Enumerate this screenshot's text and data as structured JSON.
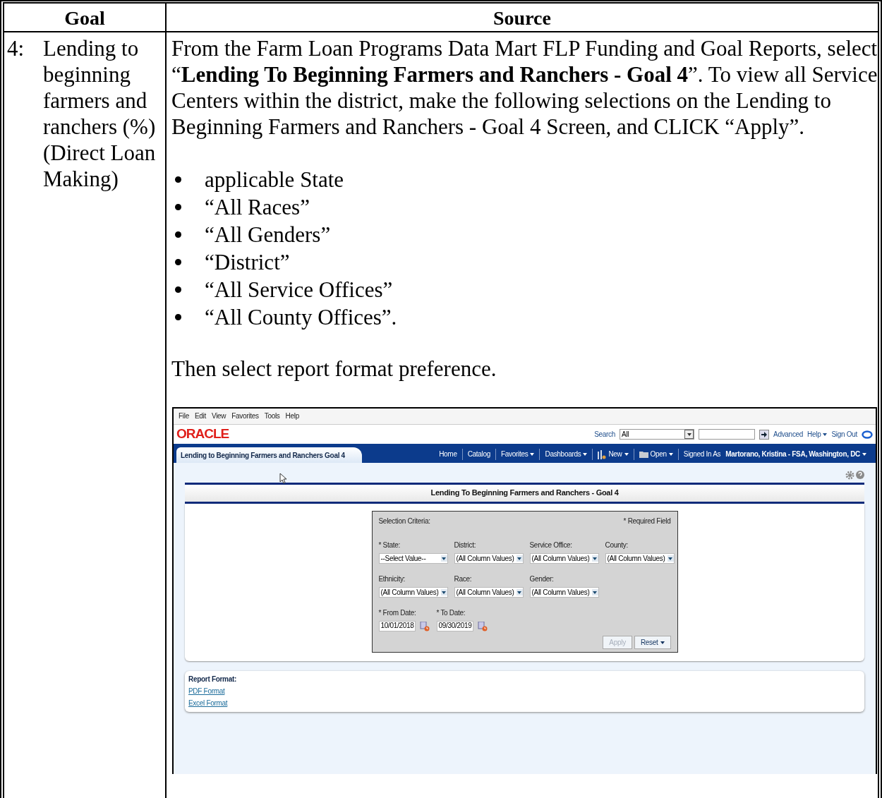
{
  "table": {
    "columns": [
      "Goal",
      "Source"
    ],
    "rows": [
      {
        "goal_number": "4:",
        "goal": "Lending to beginning farmers and ranchers (%) (Direct Loan Making)",
        "source": {
          "paragraph": "From the Farm Loan Programs Data Mart FLP Funding and Goal Reports, select “**Lending To Beginning Farmers and Ranchers - Goal 4**”.  To view all Service Centers within the district, make the following selections on the Lending to Beginning Farmers and Ranchers - Goal 4 Screen, and CLICK “Apply”.",
          "bullets": [
            "applicable State",
            "“All Races”",
            "“All Genders”",
            "“District”",
            "“All Service Offices”",
            "“All County Offices”."
          ],
          "closing": "Then select report format preference.",
          "screenshot": {
            "menu_bar": [
              "File",
              "Edit",
              "View",
              "Favorites",
              "Tools",
              "Help"
            ],
            "header": {
              "logo": "ORACLE",
              "search_label": "Search",
              "search_scope": "All",
              "links": [
                {
                  "label": "Advanced",
                  "dropdown": false
                },
                {
                  "label": "Help",
                  "dropdown": true
                },
                {
                  "label": "Sign Out",
                  "dropdown": false
                }
              ]
            },
            "nav": {
              "tab": "Lending to Beginning Farmers and Ranchers Goal 4",
              "items": [
                {
                  "label": "Home",
                  "kind": "link",
                  "dropdown": false
                },
                {
                  "label": "Catalog",
                  "kind": "link",
                  "dropdown": false
                },
                {
                  "label": "Favorites",
                  "kind": "link",
                  "dropdown": true
                },
                {
                  "label": "Dashboards",
                  "kind": "link",
                  "dropdown": true
                },
                {
                  "label": "New",
                  "kind": "new",
                  "dropdown": true
                },
                {
                  "label": "Open",
                  "kind": "open",
                  "dropdown": true
                }
              ],
              "signed_in_label": "Signed In As",
              "user": "Martorano, Kristina - FSA, Washington, DC"
            },
            "page_title": "Lending To Beginning Farmers and Ranchers - Goal 4",
            "prompt": {
              "heading": "Selection Criteria:",
              "required_note": "* Required Field",
              "rows": [
                [
                  {
                    "label": "* State:",
                    "value": "--Select Value--"
                  },
                  {
                    "label": "District:",
                    "value": "(All Column Values)"
                  },
                  {
                    "label": "Service Office:",
                    "value": "(All Column Values)"
                  },
                  {
                    "label": "County:",
                    "value": "(All Column Values)"
                  }
                ],
                [
                  {
                    "label": "Ethnicity:",
                    "value": "(All Column Values)"
                  },
                  {
                    "label": "Race:",
                    "value": "(All Column Values)"
                  },
                  {
                    "label": "Gender:",
                    "value": "(All Column Values)"
                  }
                ]
              ],
              "dates": [
                {
                  "label": "* From Date:",
                  "value": "10/01/2018"
                },
                {
                  "label": "* To Date:",
                  "value": "09/30/2019"
                }
              ],
              "buttons": [
                {
                  "label": "Apply",
                  "disabled": true,
                  "dropdown": false
                },
                {
                  "label": "Reset",
                  "disabled": false,
                  "dropdown": true
                }
              ]
            },
            "report_format": {
              "title": "Report Format:",
              "links": [
                "PDF Format",
                "Excel Format"
              ]
            }
          }
        }
      }
    ]
  }
}
